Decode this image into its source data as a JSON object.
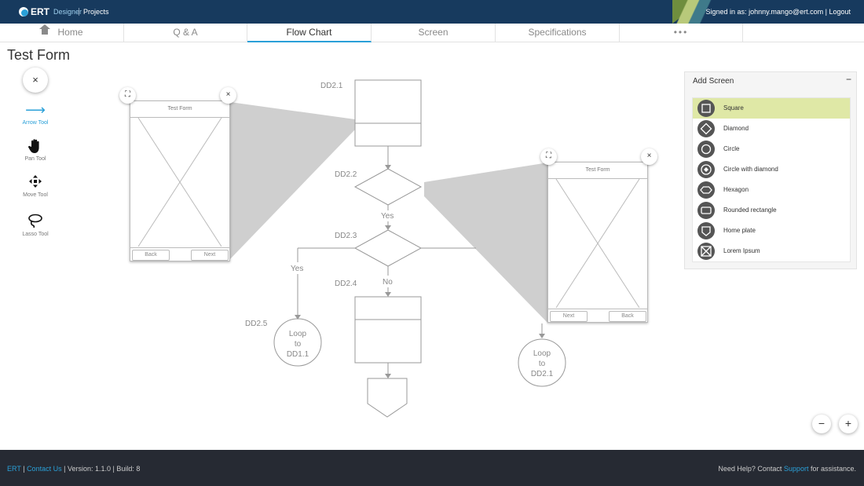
{
  "header": {
    "logo_text": "ERT",
    "nav_designer": "Designer",
    "nav_projects": "Projects",
    "signed_in_prefix": "Signed in as:",
    "user_email": "johnny.mango@ert.com",
    "separator": "|",
    "logout": "Logout"
  },
  "tabs": [
    {
      "label": "Home",
      "icon": "home-icon"
    },
    {
      "label": "Q & A"
    },
    {
      "label": "Flow Chart",
      "active": true
    },
    {
      "label": "Screen"
    },
    {
      "label": "Specifications"
    },
    {
      "label": "•••"
    }
  ],
  "page": {
    "title": "Test Form"
  },
  "toolbox": {
    "close_glyph": "×",
    "tools": [
      {
        "label": "Arrow Tool",
        "icon": "arrow-right-icon",
        "active": true
      },
      {
        "label": "Pan Tool",
        "icon": "hand-icon"
      },
      {
        "label": "Move Tool",
        "icon": "move-arrows-icon"
      },
      {
        "label": "Lasso Tool",
        "icon": "lasso-icon"
      }
    ]
  },
  "flowchart": {
    "labels": {
      "dd21": "DD2.1",
      "dd22": "DD2.2",
      "dd23": "DD2.3",
      "dd24": "DD2.4",
      "dd25": "DD2.5",
      "yes1": "Yes",
      "yes2": "Yes",
      "no": "No"
    },
    "loop1": [
      "Loop",
      "to",
      "DD1.1"
    ],
    "loop2": [
      "Loop",
      "to",
      "DD2.1"
    ]
  },
  "previews": {
    "left": {
      "title": "Test Form",
      "btn_back": "Back",
      "btn_next": "Next"
    },
    "right": {
      "title": "Test Form",
      "btn_next": "Next",
      "btn_back": "Back"
    },
    "expand_glyph": "⛶",
    "close_glyph": "×"
  },
  "panel": {
    "title": "Add Screen",
    "minimize_glyph": "−",
    "shapes": [
      {
        "label": "Square",
        "icon": "square-icon",
        "highlight": true
      },
      {
        "label": "Diamond",
        "icon": "diamond-icon"
      },
      {
        "label": "Circle",
        "icon": "circle-icon"
      },
      {
        "label": "Circle with diamond",
        "icon": "circle-diamond-icon"
      },
      {
        "label": "Hexagon",
        "icon": "hexagon-icon"
      },
      {
        "label": "Rounded rectangle",
        "icon": "rounded-rectangle-icon"
      },
      {
        "label": "Home plate",
        "icon": "home-plate-icon"
      },
      {
        "label": "Lorem Ipsum",
        "icon": "boxed-x-icon"
      }
    ]
  },
  "zoom": {
    "out": "−",
    "in": "+"
  },
  "footer": {
    "brand": "ERT",
    "sep": "|",
    "contact": "Contact Us",
    "version": "Version: 1.1.0",
    "build": "Build: 8",
    "help_prefix": "Need Help? Contact",
    "support": "Support",
    "help_suffix": "for assistance."
  },
  "colors": {
    "header_bg": "#173a5e",
    "accent": "#2aa0d8",
    "highlight": "#dfe8a6",
    "footer_bg": "#262a33"
  }
}
